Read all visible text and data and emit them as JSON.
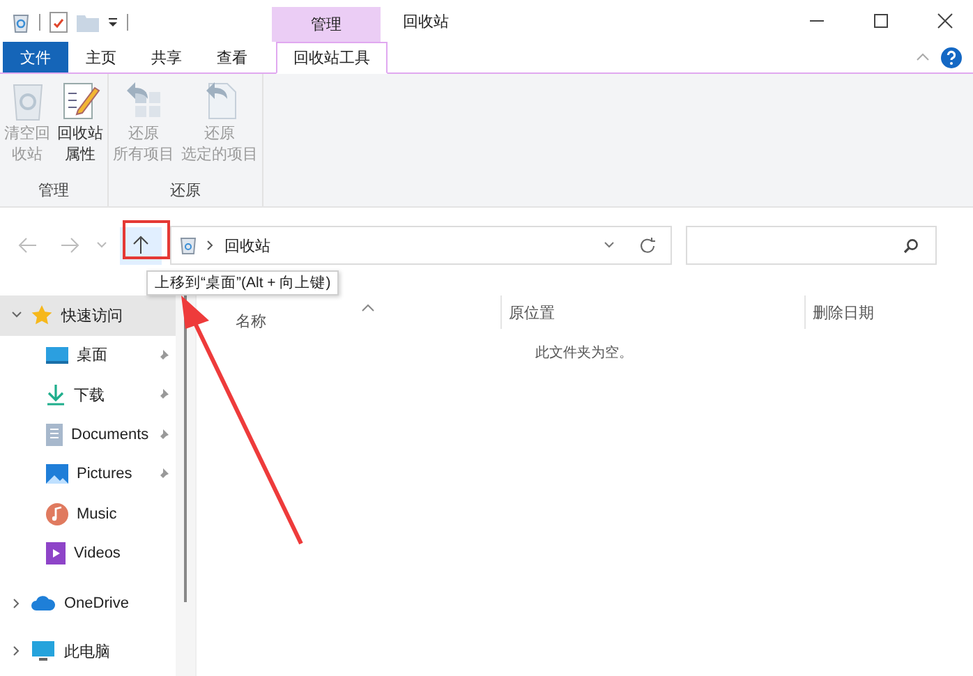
{
  "window": {
    "title": "回收站",
    "context_group": "管理"
  },
  "tabs": [
    {
      "label": "文件",
      "kind": "file",
      "selected": false
    },
    {
      "label": "主页",
      "kind": "normal",
      "selected": false
    },
    {
      "label": "共享",
      "kind": "normal",
      "selected": false
    },
    {
      "label": "查看",
      "kind": "normal",
      "selected": false
    },
    {
      "label": "回收站工具",
      "kind": "contextual",
      "selected": true
    }
  ],
  "ribbon": {
    "groups": [
      {
        "label": "管理",
        "buttons": [
          {
            "lines": [
              "清空回",
              "收站"
            ],
            "disabled": true
          },
          {
            "lines": [
              "回收站",
              "属性"
            ],
            "disabled": false
          }
        ]
      },
      {
        "label": "还原",
        "buttons": [
          {
            "lines": [
              "还原",
              "所有项目"
            ],
            "disabled": true
          },
          {
            "lines": [
              "还原",
              "选定的项目"
            ],
            "disabled": true
          }
        ]
      }
    ]
  },
  "navigation": {
    "back_disabled": true,
    "forward_disabled": true,
    "up_hovered": true
  },
  "address_bar": {
    "path": [
      "回收站"
    ]
  },
  "tooltip": "上移到“桌面”(Alt + 向上键)",
  "columns": [
    {
      "label": "名称",
      "sorted": true
    },
    {
      "label": "原位置",
      "sorted": false
    },
    {
      "label": "删除日期",
      "sorted": false
    }
  ],
  "empty_message": "此文件夹为空。",
  "sidebar": [
    {
      "label": "快速访问",
      "expanded": true,
      "selected": true,
      "children": [
        {
          "label": "桌面",
          "pinned": true
        },
        {
          "label": "下载",
          "pinned": true
        },
        {
          "label": "Documents",
          "pinned": true
        },
        {
          "label": "Pictures",
          "pinned": true
        },
        {
          "label": "Music",
          "pinned": false
        },
        {
          "label": "Videos",
          "pinned": false
        }
      ]
    },
    {
      "label": "OneDrive",
      "expanded": false,
      "selected": false
    },
    {
      "label": "此电脑",
      "expanded": false,
      "selected": false
    }
  ]
}
